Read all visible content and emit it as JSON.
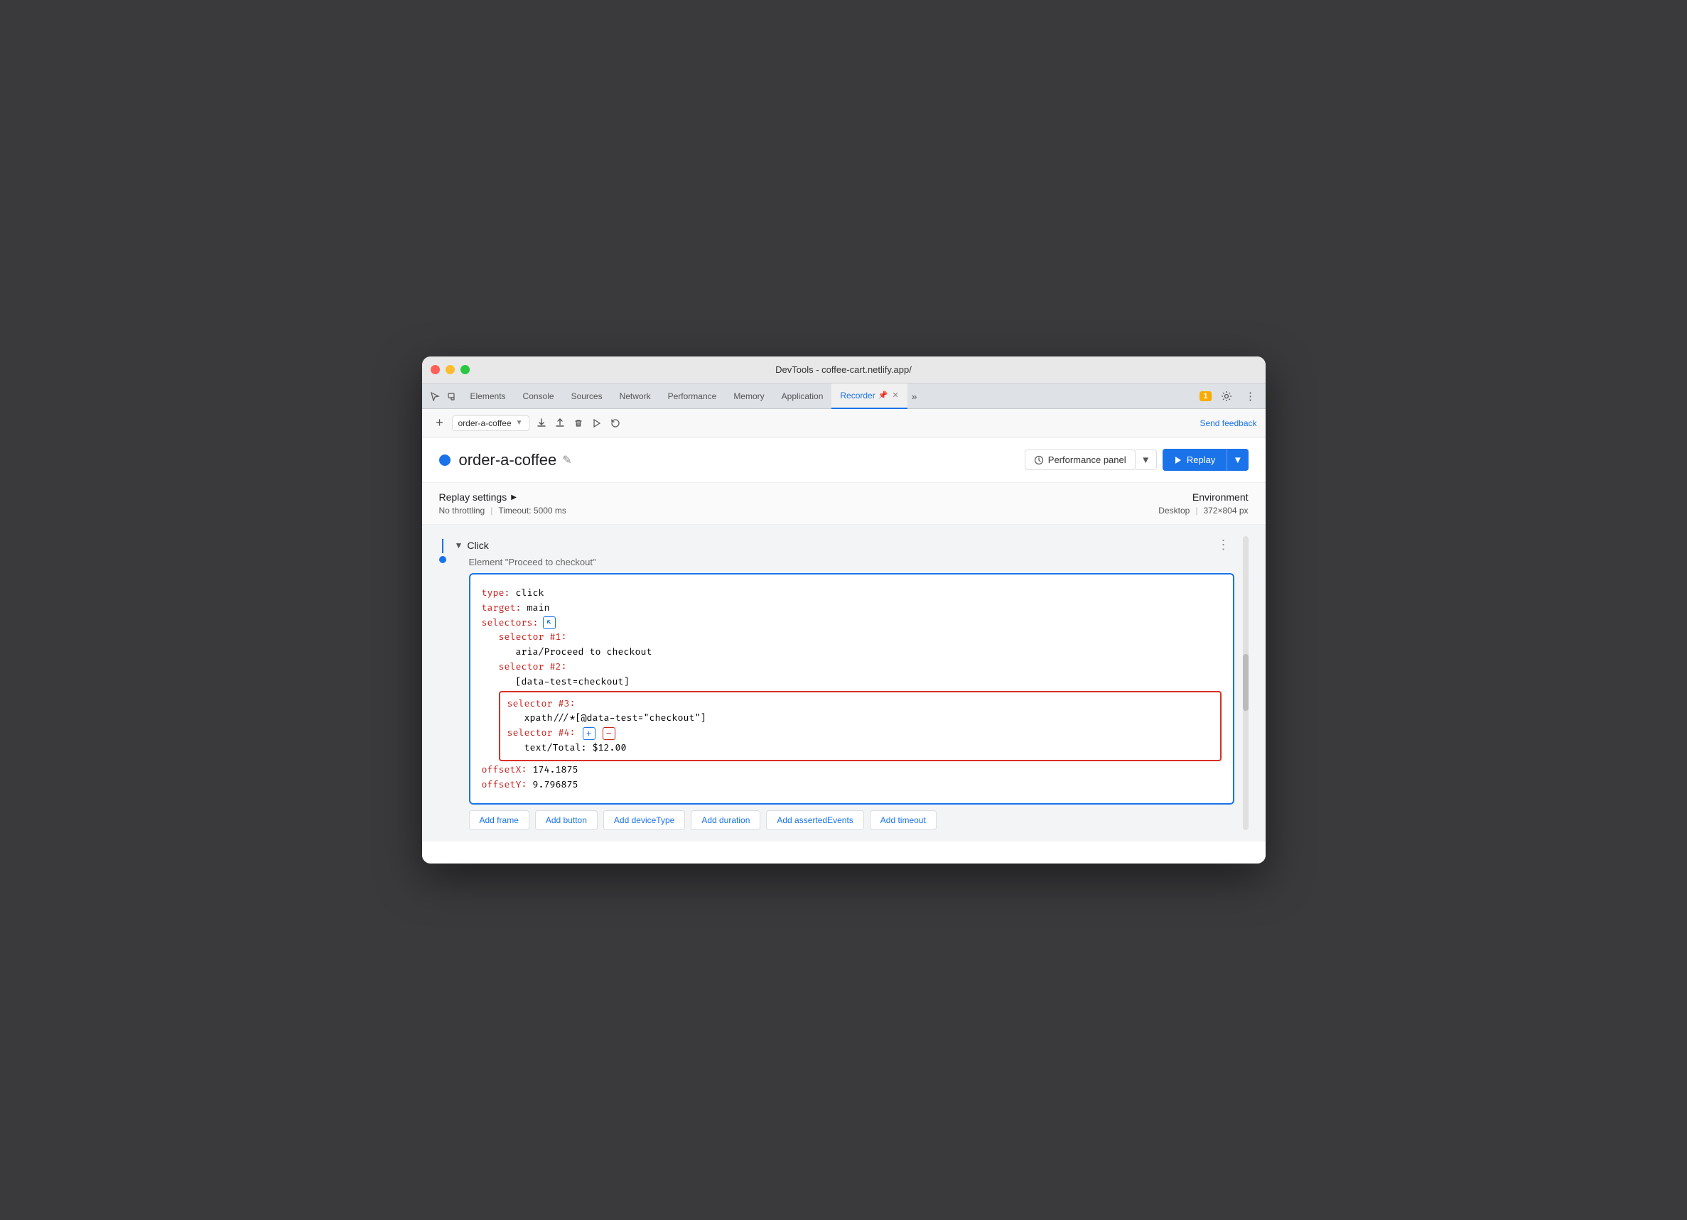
{
  "window": {
    "title": "DevTools - coffee-cart.netlify.app/"
  },
  "devtools": {
    "tabs": [
      {
        "id": "elements",
        "label": "Elements",
        "active": false
      },
      {
        "id": "console",
        "label": "Console",
        "active": false
      },
      {
        "id": "sources",
        "label": "Sources",
        "active": false
      },
      {
        "id": "network",
        "label": "Network",
        "active": false
      },
      {
        "id": "performance",
        "label": "Performance",
        "active": false
      },
      {
        "id": "memory",
        "label": "Memory",
        "active": false
      },
      {
        "id": "application",
        "label": "Application",
        "active": false
      },
      {
        "id": "recorder",
        "label": "Recorder",
        "active": true
      }
    ],
    "more_tabs_label": "»",
    "badge_count": "1",
    "send_feedback": "Send feedback"
  },
  "toolbar": {
    "recording_name": "order-a-coffee",
    "add_icon": "+",
    "export_icon": "↑",
    "import_icon": "↓",
    "delete_icon": "🗑",
    "play_icon": "▶",
    "replay_icon": "↺"
  },
  "recording": {
    "name": "order-a-coffee",
    "edit_icon": "✎",
    "perf_panel_label": "Performance panel",
    "replay_label": "Replay"
  },
  "replay_settings": {
    "title": "Replay settings",
    "expand_icon": "▶",
    "throttling": "No throttling",
    "timeout_label": "Timeout: 5000 ms",
    "environment_title": "Environment",
    "environment_value": "Desktop",
    "resolution": "372×804 px"
  },
  "step": {
    "type": "Click",
    "element": "Element \"Proceed to checkout\"",
    "code": {
      "type_key": "type:",
      "type_value": "click",
      "target_key": "target:",
      "target_value": "main",
      "selectors_key": "selectors:",
      "selector1_key": "selector #1:",
      "selector1_value": "aria/Proceed to checkout",
      "selector2_key": "selector #2:",
      "selector2_value": "[data-test=checkout]",
      "selector3_key": "selector #3:",
      "selector3_value": "xpath///*[@data-test=\"checkout\"]",
      "selector4_key": "selector #4:",
      "selector4_value": "text/Total: $12.00",
      "offsetX_key": "offsetX:",
      "offsetX_value": "174.1875",
      "offsetY_key": "offsetY:",
      "offsetY_value": "9.796875"
    },
    "action_buttons": [
      "Add frame",
      "Add button",
      "Add deviceType",
      "Add duration",
      "Add assertedEvents",
      "Add timeout"
    ]
  }
}
